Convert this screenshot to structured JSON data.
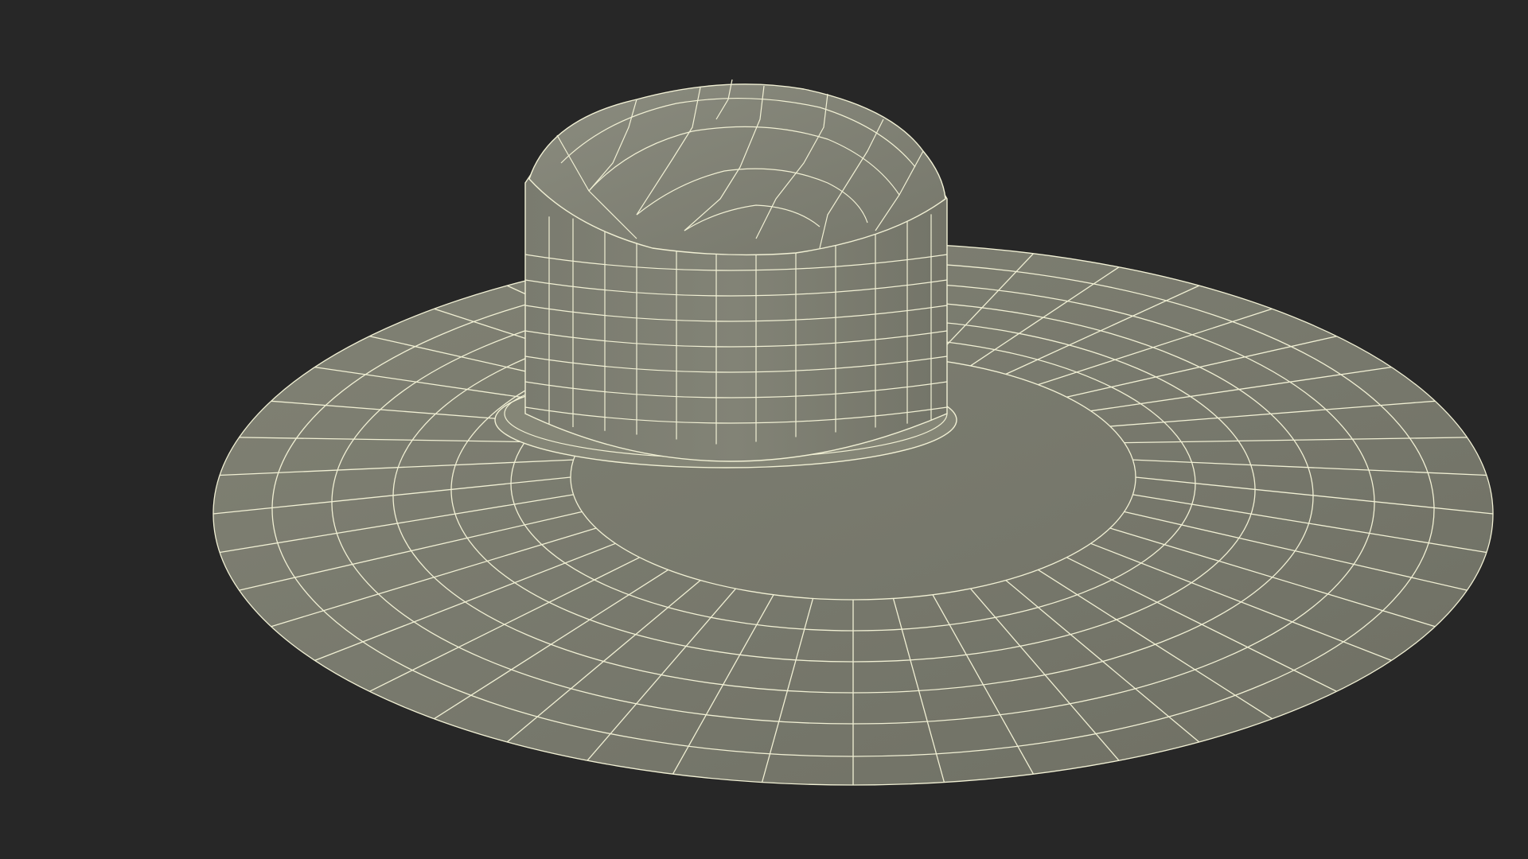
{
  "scene": {
    "subject": "wireframe-sun-hat",
    "colors": {
      "background": "#272727",
      "surface_light": "#7f7f72",
      "surface_mid": "#77786c",
      "surface_dark": "#6d6e62",
      "wire": "#f1f0d4",
      "band": "#878778"
    }
  }
}
